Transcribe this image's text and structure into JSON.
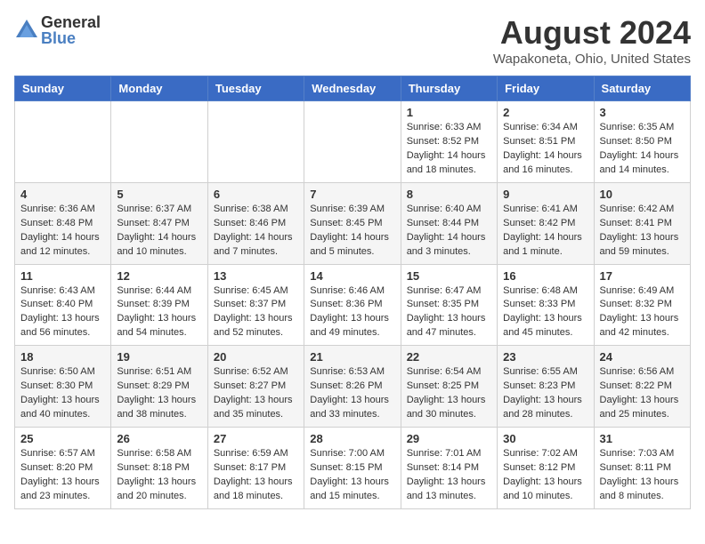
{
  "logo": {
    "general": "General",
    "blue": "Blue"
  },
  "title": "August 2024",
  "location": "Wapakoneta, Ohio, United States",
  "days_of_week": [
    "Sunday",
    "Monday",
    "Tuesday",
    "Wednesday",
    "Thursday",
    "Friday",
    "Saturday"
  ],
  "weeks": [
    [
      {
        "day": "",
        "info": ""
      },
      {
        "day": "",
        "info": ""
      },
      {
        "day": "",
        "info": ""
      },
      {
        "day": "",
        "info": ""
      },
      {
        "day": "1",
        "info": "Sunrise: 6:33 AM\nSunset: 8:52 PM\nDaylight: 14 hours and 18 minutes."
      },
      {
        "day": "2",
        "info": "Sunrise: 6:34 AM\nSunset: 8:51 PM\nDaylight: 14 hours and 16 minutes."
      },
      {
        "day": "3",
        "info": "Sunrise: 6:35 AM\nSunset: 8:50 PM\nDaylight: 14 hours and 14 minutes."
      }
    ],
    [
      {
        "day": "4",
        "info": "Sunrise: 6:36 AM\nSunset: 8:48 PM\nDaylight: 14 hours and 12 minutes."
      },
      {
        "day": "5",
        "info": "Sunrise: 6:37 AM\nSunset: 8:47 PM\nDaylight: 14 hours and 10 minutes."
      },
      {
        "day": "6",
        "info": "Sunrise: 6:38 AM\nSunset: 8:46 PM\nDaylight: 14 hours and 7 minutes."
      },
      {
        "day": "7",
        "info": "Sunrise: 6:39 AM\nSunset: 8:45 PM\nDaylight: 14 hours and 5 minutes."
      },
      {
        "day": "8",
        "info": "Sunrise: 6:40 AM\nSunset: 8:44 PM\nDaylight: 14 hours and 3 minutes."
      },
      {
        "day": "9",
        "info": "Sunrise: 6:41 AM\nSunset: 8:42 PM\nDaylight: 14 hours and 1 minute."
      },
      {
        "day": "10",
        "info": "Sunrise: 6:42 AM\nSunset: 8:41 PM\nDaylight: 13 hours and 59 minutes."
      }
    ],
    [
      {
        "day": "11",
        "info": "Sunrise: 6:43 AM\nSunset: 8:40 PM\nDaylight: 13 hours and 56 minutes."
      },
      {
        "day": "12",
        "info": "Sunrise: 6:44 AM\nSunset: 8:39 PM\nDaylight: 13 hours and 54 minutes."
      },
      {
        "day": "13",
        "info": "Sunrise: 6:45 AM\nSunset: 8:37 PM\nDaylight: 13 hours and 52 minutes."
      },
      {
        "day": "14",
        "info": "Sunrise: 6:46 AM\nSunset: 8:36 PM\nDaylight: 13 hours and 49 minutes."
      },
      {
        "day": "15",
        "info": "Sunrise: 6:47 AM\nSunset: 8:35 PM\nDaylight: 13 hours and 47 minutes."
      },
      {
        "day": "16",
        "info": "Sunrise: 6:48 AM\nSunset: 8:33 PM\nDaylight: 13 hours and 45 minutes."
      },
      {
        "day": "17",
        "info": "Sunrise: 6:49 AM\nSunset: 8:32 PM\nDaylight: 13 hours and 42 minutes."
      }
    ],
    [
      {
        "day": "18",
        "info": "Sunrise: 6:50 AM\nSunset: 8:30 PM\nDaylight: 13 hours and 40 minutes."
      },
      {
        "day": "19",
        "info": "Sunrise: 6:51 AM\nSunset: 8:29 PM\nDaylight: 13 hours and 38 minutes."
      },
      {
        "day": "20",
        "info": "Sunrise: 6:52 AM\nSunset: 8:27 PM\nDaylight: 13 hours and 35 minutes."
      },
      {
        "day": "21",
        "info": "Sunrise: 6:53 AM\nSunset: 8:26 PM\nDaylight: 13 hours and 33 minutes."
      },
      {
        "day": "22",
        "info": "Sunrise: 6:54 AM\nSunset: 8:25 PM\nDaylight: 13 hours and 30 minutes."
      },
      {
        "day": "23",
        "info": "Sunrise: 6:55 AM\nSunset: 8:23 PM\nDaylight: 13 hours and 28 minutes."
      },
      {
        "day": "24",
        "info": "Sunrise: 6:56 AM\nSunset: 8:22 PM\nDaylight: 13 hours and 25 minutes."
      }
    ],
    [
      {
        "day": "25",
        "info": "Sunrise: 6:57 AM\nSunset: 8:20 PM\nDaylight: 13 hours and 23 minutes."
      },
      {
        "day": "26",
        "info": "Sunrise: 6:58 AM\nSunset: 8:18 PM\nDaylight: 13 hours and 20 minutes."
      },
      {
        "day": "27",
        "info": "Sunrise: 6:59 AM\nSunset: 8:17 PM\nDaylight: 13 hours and 18 minutes."
      },
      {
        "day": "28",
        "info": "Sunrise: 7:00 AM\nSunset: 8:15 PM\nDaylight: 13 hours and 15 minutes."
      },
      {
        "day": "29",
        "info": "Sunrise: 7:01 AM\nSunset: 8:14 PM\nDaylight: 13 hours and 13 minutes."
      },
      {
        "day": "30",
        "info": "Sunrise: 7:02 AM\nSunset: 8:12 PM\nDaylight: 13 hours and 10 minutes."
      },
      {
        "day": "31",
        "info": "Sunrise: 7:03 AM\nSunset: 8:11 PM\nDaylight: 13 hours and 8 minutes."
      }
    ]
  ]
}
